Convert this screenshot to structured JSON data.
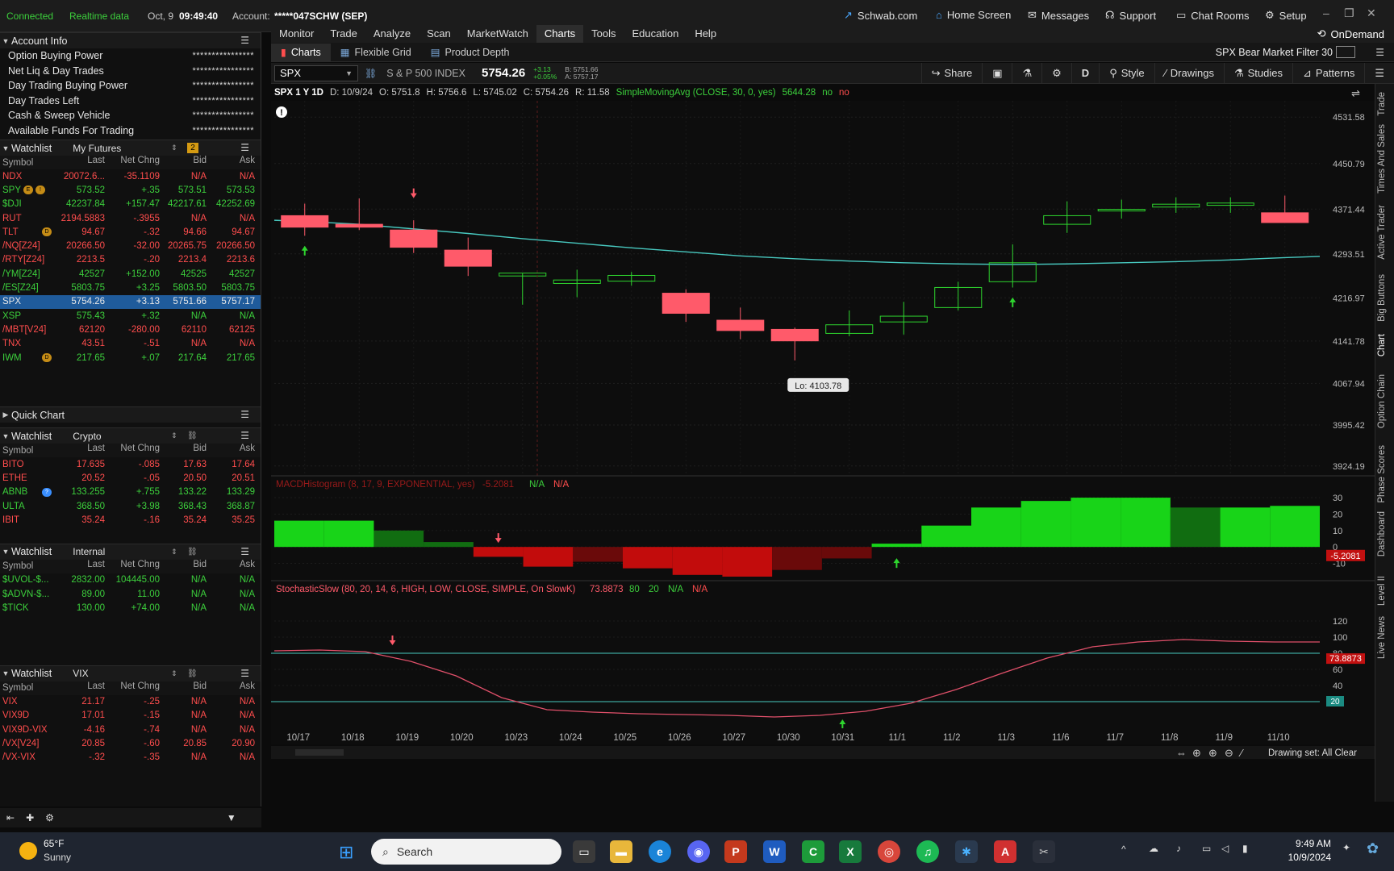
{
  "topbar": {
    "connected": "Connected",
    "realtime": "Realtime data",
    "date": "Oct, 9",
    "time": "09:49:40",
    "account_label": "Account:",
    "account": "*****047SCHW (SEP)",
    "links": [
      "Schwab.com",
      "Home Screen",
      "Messages",
      "Support",
      "Chat Rooms",
      "Setup"
    ]
  },
  "account_info": {
    "title": "Account Info",
    "rows": [
      {
        "label": "Option Buying Power",
        "value": "****************"
      },
      {
        "label": "Net Liq & Day Trades",
        "value": "****************"
      },
      {
        "label": "Day Trading Buying Power",
        "value": "****************"
      },
      {
        "label": "Day Trades Left",
        "value": "****************"
      },
      {
        "label": "Cash & Sweep Vehicle",
        "value": "****************"
      },
      {
        "label": "Available Funds For Trading",
        "value": "****************"
      }
    ]
  },
  "watchlist_futures": {
    "title": "Watchlist",
    "name": "My Futures",
    "badge": "2",
    "cols": [
      "Symbol",
      "Last",
      "Net Chng",
      "Bid",
      "Ask"
    ],
    "rows": [
      {
        "sym": "NDX",
        "last": "20072.6...",
        "chg": "-35.1109",
        "bid": "N/A",
        "ask": "N/A",
        "dir": "neg"
      },
      {
        "sym": "SPY",
        "last": "573.52",
        "chg": "+.35",
        "bid": "573.51",
        "ask": "573.53",
        "dir": "pos"
      },
      {
        "sym": "$DJI",
        "last": "42237.84",
        "chg": "+157.47",
        "bid": "42217.61",
        "ask": "42252.69",
        "dir": "pos"
      },
      {
        "sym": "RUT",
        "last": "2194.5883",
        "chg": "-.3955",
        "bid": "N/A",
        "ask": "N/A",
        "dir": "neg"
      },
      {
        "sym": "TLT",
        "last": "94.67",
        "chg": "-.32",
        "bid": "94.66",
        "ask": "94.67",
        "dir": "neg"
      },
      {
        "sym": "/NQ[Z24]",
        "last": "20266.50",
        "chg": "-32.00",
        "bid": "20265.75",
        "ask": "20266.50",
        "dir": "neg"
      },
      {
        "sym": "/RTY[Z24]",
        "last": "2213.5",
        "chg": "-.20",
        "bid": "2213.4",
        "ask": "2213.6",
        "dir": "neg"
      },
      {
        "sym": "/YM[Z24]",
        "last": "42527",
        "chg": "+152.00",
        "bid": "42525",
        "ask": "42527",
        "dir": "pos"
      },
      {
        "sym": "/ES[Z24]",
        "last": "5803.75",
        "chg": "+3.25",
        "bid": "5803.50",
        "ask": "5803.75",
        "dir": "pos"
      },
      {
        "sym": "SPX",
        "last": "5754.26",
        "chg": "+3.13",
        "bid": "5751.66",
        "ask": "5757.17",
        "dir": "sel"
      },
      {
        "sym": "XSP",
        "last": "575.43",
        "chg": "+.32",
        "bid": "N/A",
        "ask": "N/A",
        "dir": "pos"
      },
      {
        "sym": "/MBT[V24]",
        "last": "62120",
        "chg": "-280.00",
        "bid": "62110",
        "ask": "62125",
        "dir": "neg"
      },
      {
        "sym": "TNX",
        "last": "43.51",
        "chg": "-.51",
        "bid": "N/A",
        "ask": "N/A",
        "dir": "neg"
      },
      {
        "sym": "IWM",
        "last": "217.65",
        "chg": "+.07",
        "bid": "217.64",
        "ask": "217.65",
        "dir": "pos"
      }
    ]
  },
  "quick_chart": "Quick Chart",
  "watchlist_crypto": {
    "title": "Watchlist",
    "name": "Crypto",
    "cols": [
      "Symbol",
      "Last",
      "Net Chng",
      "Bid",
      "Ask"
    ],
    "rows": [
      {
        "sym": "BITO",
        "last": "17.635",
        "chg": "-.085",
        "bid": "17.63",
        "ask": "17.64",
        "dir": "neg"
      },
      {
        "sym": "ETHE",
        "last": "20.52",
        "chg": "-.05",
        "bid": "20.50",
        "ask": "20.51",
        "dir": "neg"
      },
      {
        "sym": "ABNB",
        "last": "133.255",
        "chg": "+.755",
        "bid": "133.22",
        "ask": "133.29",
        "dir": "pos"
      },
      {
        "sym": "ULTA",
        "last": "368.50",
        "chg": "+3.98",
        "bid": "368.43",
        "ask": "368.87",
        "dir": "pos"
      },
      {
        "sym": "IBIT",
        "last": "35.24",
        "chg": "-.16",
        "bid": "35.24",
        "ask": "35.25",
        "dir": "neg"
      }
    ]
  },
  "watchlist_internal": {
    "title": "Watchlist",
    "name": "Internal",
    "cols": [
      "Symbol",
      "Last",
      "Net Chng",
      "Bid",
      "Ask"
    ],
    "rows": [
      {
        "sym": "$UVOL-$...",
        "last": "2832.00",
        "chg": "104445.00",
        "bid": "N/A",
        "ask": "N/A",
        "dir": "pos"
      },
      {
        "sym": "$ADVN-$...",
        "last": "89.00",
        "chg": "11.00",
        "bid": "N/A",
        "ask": "N/A",
        "dir": "pos"
      },
      {
        "sym": "$TICK",
        "last": "130.00",
        "chg": "+74.00",
        "bid": "N/A",
        "ask": "N/A",
        "dir": "pos"
      }
    ]
  },
  "watchlist_vix": {
    "title": "Watchlist",
    "name": "VIX",
    "cols": [
      "Symbol",
      "Last",
      "Net Chng",
      "Bid",
      "Ask"
    ],
    "rows": [
      {
        "sym": "VIX",
        "last": "21.17",
        "chg": "-.25",
        "bid": "N/A",
        "ask": "N/A",
        "dir": "neg"
      },
      {
        "sym": "VIX9D",
        "last": "17.01",
        "chg": "-.15",
        "bid": "N/A",
        "ask": "N/A",
        "dir": "neg"
      },
      {
        "sym": "VIX9D-VIX",
        "last": "-4.16",
        "chg": "-.74",
        "bid": "N/A",
        "ask": "N/A",
        "dir": "neg"
      },
      {
        "sym": "/VX[V24]",
        "last": "20.85",
        "chg": "-.60",
        "bid": "20.85",
        "ask": "20.90",
        "dir": "neg"
      },
      {
        "sym": "/VX-VIX",
        "last": "-.32",
        "chg": "-.35",
        "bid": "N/A",
        "ask": "N/A",
        "dir": "neg"
      }
    ]
  },
  "menu": [
    "Monitor",
    "Trade",
    "Analyze",
    "Scan",
    "MarketWatch",
    "Charts",
    "Tools",
    "Education",
    "Help"
  ],
  "menu_active": "Charts",
  "ondemand": "OnDemand",
  "subtabs": [
    "Charts",
    "Flexible Grid",
    "Product Depth"
  ],
  "filter_label": "SPX Bear Market Filter 30",
  "symbol": {
    "value": "SPX",
    "desc": "S & P 500 INDEX",
    "price": "5754.26",
    "chg": "+3.13",
    "pct": "+0.05%",
    "bid": "B: 5751.66",
    "ask": "A: 5757.17"
  },
  "tools": [
    "Share",
    "Style",
    "Drawings",
    "Studies",
    "Patterns"
  ],
  "tool_d": "D",
  "info": {
    "period": "SPX 1 Y 1D",
    "d": "D: 10/9/24",
    "o": "O: 5751.8",
    "h": "H: 5756.6",
    "l": "L: 5745.02",
    "c": "C: 5754.26",
    "r": "R: 11.58",
    "sma": "SimpleMovingAvg (CLOSE, 30, 0, yes)",
    "sma_val": "5644.28",
    "no1": "no",
    "no2": "no"
  },
  "macd_label": {
    "name": "MACDHistogram (8, 17, 9, EXPONENTIAL, yes)",
    "val": "-5.2081",
    "na1": "N/A",
    "na2": "N/A"
  },
  "stoch_label": {
    "name": "StochasticSlow (80, 20, 14, 6, HIGH, LOW, CLOSE, SIMPLE, On SlowK)",
    "val": "73.8873",
    "ob": "80",
    "os": "20",
    "na1": "N/A",
    "na2": "N/A"
  },
  "lo_tooltip": "Lo: 4103.78",
  "drawing_set": "Drawing set: All Clear",
  "rightrail": [
    "Trade",
    "Times And Sales",
    "Active Trader",
    "Big Buttons",
    "Chart",
    "Option Chain",
    "Phase Scores",
    "Dashboard",
    "Level II",
    "Live News"
  ],
  "chart_data": [
    {
      "type": "candlestick",
      "title": "SPX 1 Y 1D",
      "x": [
        "10/17",
        "10/18",
        "10/19",
        "10/20",
        "10/23",
        "10/24",
        "10/25",
        "10/26",
        "10/27",
        "10/30",
        "10/31",
        "11/1",
        "11/2",
        "11/3",
        "11/6",
        "11/7",
        "11/8",
        "11/9",
        "11/10"
      ],
      "open": [
        4360,
        4345,
        4335,
        4300,
        4255,
        4242,
        4246,
        4225,
        4178,
        4162,
        4155,
        4175,
        4200,
        4245,
        4345,
        4369,
        4375,
        4378,
        4365
      ],
      "high": [
        4381,
        4390,
        4352,
        4322,
        4260,
        4266,
        4262,
        4232,
        4200,
        4165,
        4195,
        4210,
        4245,
        4310,
        4385,
        4388,
        4392,
        4392,
        4395
      ],
      "low": [
        4325,
        4335,
        4295,
        4255,
        4205,
        4218,
        4238,
        4175,
        4145,
        4108,
        4150,
        4153,
        4195,
        4235,
        4330,
        4355,
        4365,
        4365,
        4360
      ],
      "close": [
        4340,
        4340,
        4305,
        4272,
        4260,
        4248,
        4256,
        4190,
        4160,
        4142,
        4170,
        4185,
        4235,
        4278,
        4360,
        4371,
        4380,
        4382,
        4348
      ],
      "ylim": [
        3900,
        4560
      ],
      "yticks": [
        4531.58,
        4450.79,
        4371.44,
        4293.51,
        4216.97,
        4141.78,
        4067.94,
        3995.42,
        3924.19
      ],
      "sma": [
        4350,
        4345,
        4337,
        4329,
        4320,
        4312,
        4304,
        4297,
        4290,
        4285,
        4281,
        4278,
        4276,
        4275,
        4276,
        4278,
        4280,
        4283,
        4287
      ]
    },
    {
      "type": "bar",
      "title": "MACDHistogram",
      "values": [
        16,
        16,
        10,
        3,
        -6,
        -12,
        -9,
        -13,
        -17,
        -19,
        -14,
        -7,
        2,
        13,
        24,
        28,
        30,
        30,
        24,
        24,
        25
      ],
      "ylim": [
        -22,
        32
      ],
      "yticks": [
        30,
        20,
        10,
        0,
        -10,
        -20
      ],
      "last_value": "-5.2081"
    },
    {
      "type": "line",
      "title": "StochasticSlow",
      "values": [
        83,
        84,
        82,
        70,
        52,
        25,
        10,
        7,
        5,
        4,
        3,
        1,
        3,
        8,
        18,
        35,
        55,
        74,
        88,
        94,
        97,
        95,
        94,
        94
      ],
      "ylim": [
        -5,
        125
      ],
      "yticks": [
        120,
        100,
        80,
        60,
        40,
        20
      ],
      "overbought": 80,
      "oversold": 20,
      "last_value": "73.8873"
    }
  ],
  "taskbar": {
    "weather_temp": "65°F",
    "weather_desc": "Sunny",
    "search": "Search",
    "clock_time": "9:49 AM",
    "clock_date": "10/9/2024"
  }
}
